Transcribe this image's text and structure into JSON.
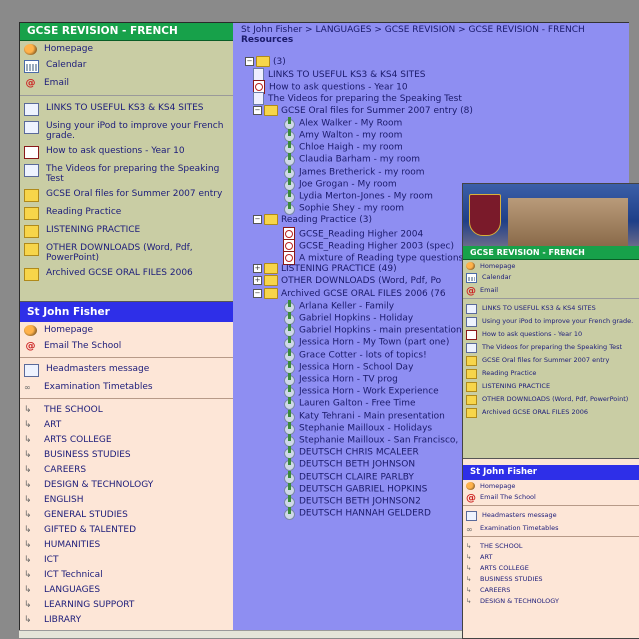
{
  "left_panel": {
    "section_title": "GCSE REVISION - FRENCH",
    "gcse_items": [
      {
        "label": "Homepage",
        "icon": "home-icon"
      },
      {
        "label": "Calendar",
        "icon": "calendar-icon"
      },
      {
        "label": "Email",
        "icon": "email-icon"
      },
      {
        "label": "LINKS TO USEFUL KS3 & KS4 SITES",
        "icon": "document-icon"
      },
      {
        "label": "Using your iPod to improve your French grade.",
        "icon": "document-icon"
      },
      {
        "label": "How to ask questions - Year 10",
        "icon": "pdf-icon"
      },
      {
        "label": "The Videos for preparing the Speaking Test",
        "icon": "document-icon"
      },
      {
        "label": "GCSE Oral files for Summer 2007 entry",
        "icon": "folder-icon"
      },
      {
        "label": "Reading Practice",
        "icon": "folder-icon"
      },
      {
        "label": "LISTENING PRACTICE",
        "icon": "folder-icon"
      },
      {
        "label": "OTHER DOWNLOADS (Word, Pdf, PowerPoint)",
        "icon": "folder-icon"
      },
      {
        "label": "Archived GCSE ORAL FILES 2006",
        "icon": "folder-icon"
      }
    ],
    "school_title": "St John Fisher",
    "school_items": [
      {
        "label": "Homepage",
        "icon": "home-icon"
      },
      {
        "label": "Email The School",
        "icon": "email-icon"
      }
    ],
    "school_items2": [
      {
        "label": "Headmasters message",
        "icon": "document-icon"
      },
      {
        "label": "Examination Timetables",
        "icon": "glasses-icon"
      }
    ],
    "subjects": [
      "THE SCHOOL",
      "ART",
      "ARTS COLLEGE",
      "BUSINESS STUDIES",
      "CAREERS",
      "DESIGN & TECHNOLOGY",
      "ENGLISH",
      "GENERAL STUDIES",
      "GIFTED & TALENTED",
      "HUMANITIES",
      "ICT",
      "ICT Technical",
      "LANGUAGES",
      "LEARNING SUPPORT",
      "LIBRARY"
    ]
  },
  "main": {
    "breadcrumb": "St John Fisher > LANGUAGES > GCSE REVISION > GCSE REVISION - FRENCH",
    "resources_label": "Resources",
    "root_label": "(3)",
    "tree": [
      {
        "label": "LINKS TO USEFUL KS3 & KS4 SITES",
        "kind": "doc",
        "depth": 1
      },
      {
        "label": "How to ask questions - Year 10",
        "kind": "pdf",
        "depth": 1
      },
      {
        "label": "The Videos for preparing the Speaking Test",
        "kind": "doc",
        "depth": 1
      },
      {
        "label": "GCSE Oral files for Summer 2007 entry (8)",
        "kind": "folder",
        "depth": 1,
        "toggle": "-"
      },
      {
        "label": "Alex Walker - My Room",
        "kind": "sound",
        "depth": 2
      },
      {
        "label": "Amy Walton - my room",
        "kind": "sound",
        "depth": 2
      },
      {
        "label": "Chloe Haigh - my room",
        "kind": "sound",
        "depth": 2
      },
      {
        "label": "Claudia Barham - my room",
        "kind": "sound",
        "depth": 2
      },
      {
        "label": "James Bretherick - my room",
        "kind": "sound",
        "depth": 2
      },
      {
        "label": "Joe Grogan - My room",
        "kind": "sound",
        "depth": 2
      },
      {
        "label": "Lydia Merton-Jones - My room",
        "kind": "sound",
        "depth": 2
      },
      {
        "label": "Sophie Shey - my room",
        "kind": "sound",
        "depth": 2
      },
      {
        "label": "Reading Practice (3)",
        "kind": "folder",
        "depth": 1,
        "toggle": "-"
      },
      {
        "label": "GCSE_Reading Higher 2004",
        "kind": "pdf",
        "depth": 2
      },
      {
        "label": "GCSE_Reading Higher 2003 (spec)",
        "kind": "pdf",
        "depth": 2
      },
      {
        "label": "A mixture of Reading type questions f",
        "kind": "pdf",
        "depth": 2
      },
      {
        "label": "LISTENING PRACTICE (49)",
        "kind": "folder",
        "depth": 1,
        "toggle": "+"
      },
      {
        "label": "OTHER DOWNLOADS (Word, Pdf, Po",
        "kind": "folder",
        "depth": 1,
        "toggle": "+"
      },
      {
        "label": "Archived GCSE ORAL FILES 2006 (76",
        "kind": "folder",
        "depth": 1,
        "toggle": "-"
      },
      {
        "label": "Arlana Keller - Family",
        "kind": "sound",
        "depth": 2
      },
      {
        "label": "Gabriel Hopkins - Holiday",
        "kind": "sound",
        "depth": 2
      },
      {
        "label": "Gabriel Hopkins - main presentation",
        "kind": "sound",
        "depth": 2
      },
      {
        "label": "Jessica Horn - My Town (part one)",
        "kind": "sound",
        "depth": 2
      },
      {
        "label": "Grace Cotter - lots of topics!",
        "kind": "sound",
        "depth": 2
      },
      {
        "label": "Jessica Horn - School Day",
        "kind": "sound",
        "depth": 2
      },
      {
        "label": "Jessica Horn - TV prog",
        "kind": "sound",
        "depth": 2
      },
      {
        "label": "Jessica Horn - Work Experience",
        "kind": "sound",
        "depth": 2
      },
      {
        "label": "Lauren Galton - Free Time",
        "kind": "sound",
        "depth": 2
      },
      {
        "label": "Katy Tehrani - Main presentation",
        "kind": "sound",
        "depth": 2
      },
      {
        "label": "Stephanie Mailloux - Holidays",
        "kind": "sound",
        "depth": 2
      },
      {
        "label": "Stephanie Mailloux - San Francisco, F",
        "kind": "sound",
        "depth": 2
      },
      {
        "label": "DEUTSCH CHRIS MCALEER",
        "kind": "sound",
        "depth": 2
      },
      {
        "label": "DEUTSCH BETH JOHNSON",
        "kind": "sound",
        "depth": 2
      },
      {
        "label": "DEUTSCH CLAIRE PARLBY",
        "kind": "sound",
        "depth": 2
      },
      {
        "label": "DEUTSCH GABRIEL HOPKINS",
        "kind": "sound",
        "depth": 2
      },
      {
        "label": "DEUTSCH BETH JOHNSON2",
        "kind": "sound",
        "depth": 2
      },
      {
        "label": "DEUTSCH HANNAH GELDERD",
        "kind": "sound",
        "depth": 2
      }
    ]
  },
  "overlay": {
    "section_title": "GCSE REVISION - FRENCH",
    "school_title": "St John Fisher",
    "subjects": [
      "THE SCHOOL",
      "ART",
      "ARTS COLLEGE",
      "BUSINESS STUDIES",
      "CAREERS",
      "DESIGN & TECHNOLOGY"
    ]
  },
  "colors": {
    "green_header": "#17a14a",
    "blue_header": "#2e2fe8",
    "main_bg": "#8e8ef2",
    "panel_bg": "#fde6d7",
    "gcse_bg": "#c9cda4"
  }
}
